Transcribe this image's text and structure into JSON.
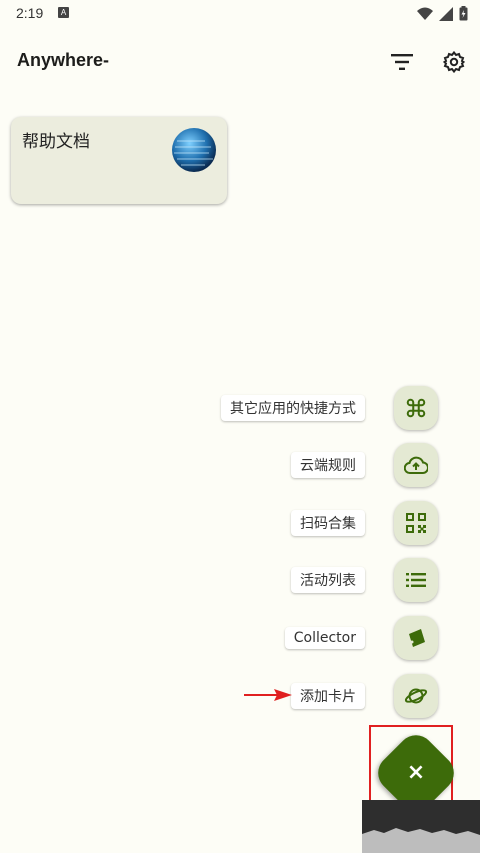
{
  "status": {
    "time": "2:19",
    "notif_letter": "A"
  },
  "app": {
    "title": "Anywhere-"
  },
  "card": {
    "title": "帮助文档"
  },
  "actions": [
    {
      "label": "其它应用的快捷方式",
      "icon": "command-icon"
    },
    {
      "label": "云端规则",
      "icon": "cloud-upload-icon"
    },
    {
      "label": "扫码合集",
      "icon": "qr-code-icon"
    },
    {
      "label": "活动列表",
      "icon": "list-icon"
    },
    {
      "label": "Collector",
      "icon": "collector-icon"
    },
    {
      "label": "添加卡片",
      "icon": "planet-icon"
    }
  ],
  "fab": {
    "symbol": "×"
  },
  "colors": {
    "accent": "#3d6b0a",
    "action_bg": "#e4e9d3",
    "card_bg": "#ecedde",
    "highlight": "#e02020"
  }
}
